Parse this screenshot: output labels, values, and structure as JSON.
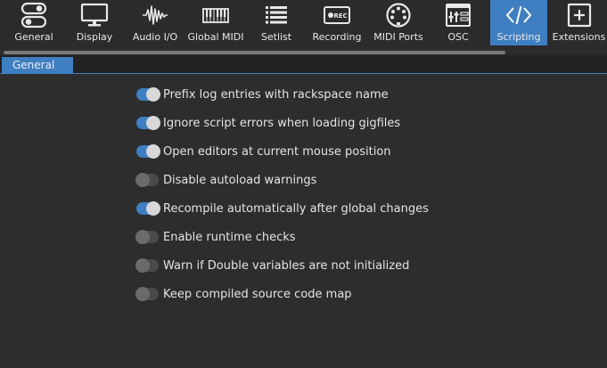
{
  "toolbar": {
    "items": [
      {
        "label": "General",
        "icon": "sliders-toggle-icon"
      },
      {
        "label": "Display",
        "icon": "monitor-icon"
      },
      {
        "label": "Audio I/O",
        "icon": "waveform-icon"
      },
      {
        "label": "Global MIDI",
        "icon": "keyboard-icon"
      },
      {
        "label": "Setlist",
        "icon": "list-icon"
      },
      {
        "label": "Recording",
        "icon": "rec-icon"
      },
      {
        "label": "MIDI Ports",
        "icon": "midi-din-icon"
      },
      {
        "label": "OSC",
        "icon": "osc-panel-icon"
      },
      {
        "label": "Scripting",
        "icon": "code-icon",
        "active": true
      },
      {
        "label": "Extensions",
        "icon": "plus-box-icon"
      }
    ]
  },
  "tabs": [
    {
      "label": "General",
      "active": true
    }
  ],
  "options": [
    {
      "label": "Prefix log entries with rackspace name",
      "on": true
    },
    {
      "label": "Ignore script errors when loading gigfiles",
      "on": true
    },
    {
      "label": "Open editors at current mouse position",
      "on": true
    },
    {
      "label": "Disable autoload warnings",
      "on": false
    },
    {
      "label": "Recompile automatically after global changes",
      "on": true
    },
    {
      "label": "Enable runtime checks",
      "on": false
    },
    {
      "label": "Warn if Double variables are not initialized",
      "on": false
    },
    {
      "label": "Keep compiled source code map",
      "on": false
    }
  ],
  "colors": {
    "accent": "#3f7fc1",
    "background": "#2d2d2d",
    "toolbar": "#2b2b2b"
  }
}
